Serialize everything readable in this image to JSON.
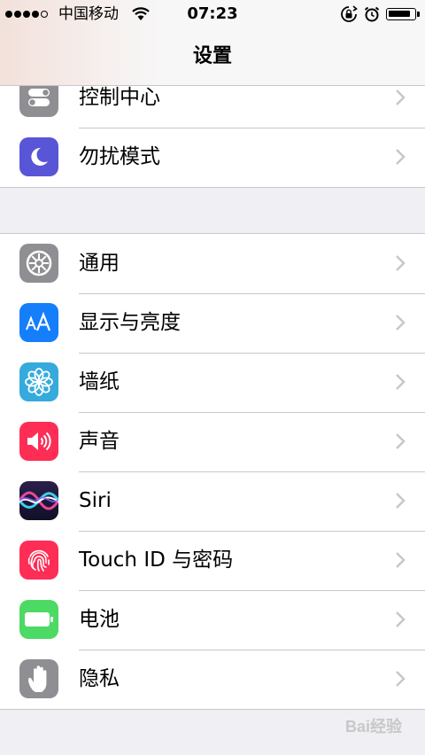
{
  "status_bar": {
    "carrier": "中国移动",
    "time": "07:23"
  },
  "nav": {
    "title": "设置"
  },
  "group1": [
    {
      "label": "控制中心",
      "icon": "control-center-icon",
      "color": "#8e8e93"
    },
    {
      "label": "勿扰模式",
      "icon": "moon-icon",
      "color": "#5856d6"
    }
  ],
  "group2": [
    {
      "label": "通用",
      "icon": "gear-icon",
      "color": "#8e8e93"
    },
    {
      "label": "显示与亮度",
      "icon": "text-size-icon",
      "color": "#147efb"
    },
    {
      "label": "墙纸",
      "icon": "flower-icon",
      "color": "#35aadc"
    },
    {
      "label": "声音",
      "icon": "speaker-icon",
      "color": "#fe2d55"
    },
    {
      "label": "Siri",
      "icon": "siri-icon",
      "color": "#1a1a3a"
    },
    {
      "label": "Touch ID 与密码",
      "icon": "fingerprint-icon",
      "color": "#fe2d55"
    },
    {
      "label": "电池",
      "icon": "battery-icon",
      "color": "#4cd964"
    },
    {
      "label": "隐私",
      "icon": "hand-icon",
      "color": "#8e8e93"
    }
  ],
  "watermark": "Bai经验"
}
